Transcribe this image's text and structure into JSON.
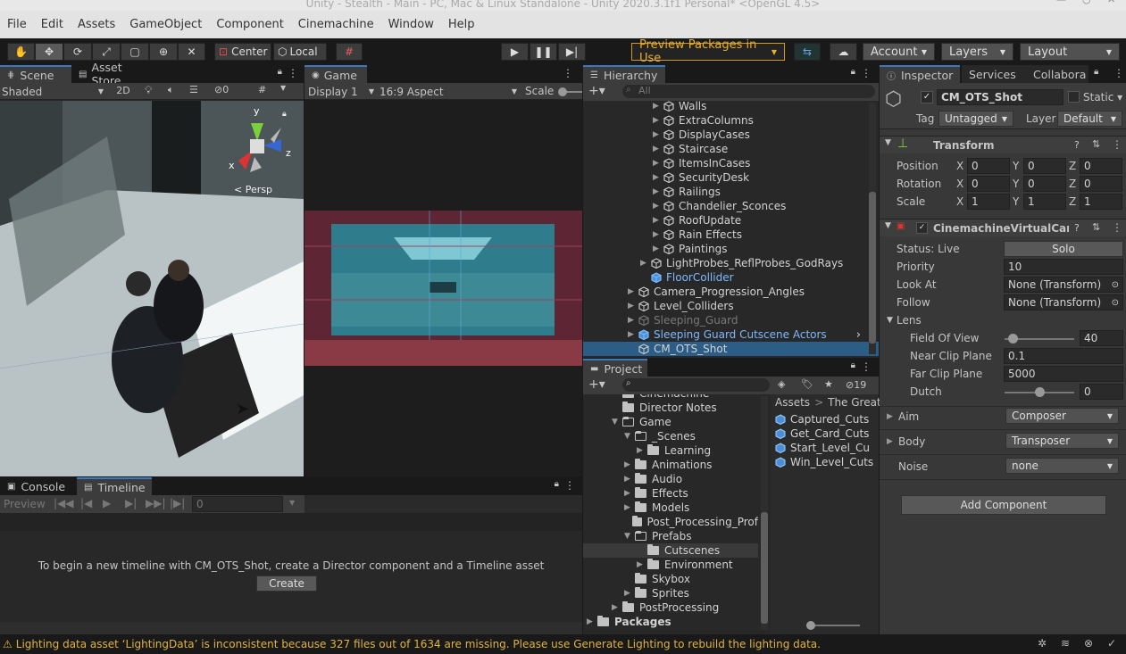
{
  "window": {
    "title": "Unity - Stealth - Main - PC, Mac & Linux Standalone - Unity 2020.3.1f1 Personal* <OpenGL 4.5>"
  },
  "menu": [
    "File",
    "Edit",
    "Assets",
    "GameObject",
    "Component",
    "Cinemachine",
    "Window",
    "Help"
  ],
  "toolbar": {
    "pivot_center": "Center",
    "pivot_local": "Local",
    "preview_packages": "Preview Packages in Use",
    "account": "Account",
    "layers": "Layers",
    "layout": "Layout"
  },
  "scene": {
    "tab_scene": "Scene",
    "tab_asset_store": "Asset Store",
    "shading": "Shaded",
    "mode_2d": "2D",
    "hidden_count": "0",
    "gizmo_persp": "< Persp",
    "axis_x": "x",
    "axis_y": "y",
    "axis_z": "z"
  },
  "game": {
    "tab": "Game",
    "display": "Display 1",
    "aspect": "16:9 Aspect",
    "scale_label": "Scale"
  },
  "hierarchy": {
    "tab": "Hierarchy",
    "search_placeholder": "All",
    "items": [
      {
        "label": "Walls",
        "indent": 5,
        "arrow": true,
        "style": "normal"
      },
      {
        "label": "ExtraColumns",
        "indent": 5,
        "arrow": true,
        "style": "normal"
      },
      {
        "label": "DisplayCases",
        "indent": 5,
        "arrow": true,
        "style": "normal"
      },
      {
        "label": "Staircase",
        "indent": 5,
        "arrow": true,
        "style": "normal"
      },
      {
        "label": "ItemsInCases",
        "indent": 5,
        "arrow": true,
        "style": "normal"
      },
      {
        "label": "SecurityDesk",
        "indent": 5,
        "arrow": true,
        "style": "normal"
      },
      {
        "label": "Railings",
        "indent": 5,
        "arrow": true,
        "style": "normal"
      },
      {
        "label": "Chandelier_Sconces",
        "indent": 5,
        "arrow": true,
        "style": "normal"
      },
      {
        "label": "RoofUpdate",
        "indent": 5,
        "arrow": true,
        "style": "normal"
      },
      {
        "label": "Rain Effects",
        "indent": 5,
        "arrow": true,
        "style": "normal"
      },
      {
        "label": "Paintings",
        "indent": 5,
        "arrow": true,
        "style": "normal"
      },
      {
        "label": "LightProbes_ReflProbes_GodRays",
        "indent": 4,
        "arrow": true,
        "style": "normal"
      },
      {
        "label": "FloorCollider",
        "indent": 4,
        "arrow": false,
        "style": "prefab"
      },
      {
        "label": "Camera_Progression_Angles",
        "indent": 3,
        "arrow": true,
        "style": "normal"
      },
      {
        "label": "Level_Colliders",
        "indent": 3,
        "arrow": true,
        "style": "normal"
      },
      {
        "label": "Sleeping_Guard",
        "indent": 3,
        "arrow": true,
        "style": "disabled"
      },
      {
        "label": "Sleeping Guard Cutscene Actors",
        "indent": 3,
        "arrow": true,
        "style": "prefab"
      },
      {
        "label": "CM_OTS_Shot",
        "indent": 3,
        "arrow": false,
        "style": "selected"
      }
    ]
  },
  "inspector": {
    "tab_inspector": "Inspector",
    "tab_services": "Services",
    "tab_collab": "Collabora",
    "object_name": "CM_OTS_Shot",
    "static_label": "Static",
    "tag_label": "Tag",
    "tag_value": "Untagged",
    "layer_label": "Layer",
    "layer_value": "Default",
    "transform": {
      "title": "Transform",
      "rows": [
        {
          "label": "Position",
          "x": "0",
          "y": "0",
          "z": "0"
        },
        {
          "label": "Rotation",
          "x": "0",
          "y": "0",
          "z": "0"
        },
        {
          "label": "Scale",
          "x": "1",
          "y": "1",
          "z": "1"
        }
      ],
      "x": "X",
      "y": "Y",
      "z": "Z"
    },
    "vcam": {
      "title": "CinemachineVirtualCamer",
      "status_label": "Status: Live",
      "solo": "Solo",
      "priority_label": "Priority",
      "priority": "10",
      "lookat_label": "Look At",
      "lookat": "None (Transform)",
      "follow_label": "Follow",
      "follow": "None (Transform)",
      "lens_label": "Lens",
      "fov_label": "Field Of View",
      "fov": "40",
      "fov_fraction": 0.11,
      "near_label": "Near Clip Plane",
      "near": "0.1",
      "far_label": "Far Clip Plane",
      "far": "5000",
      "dutch_label": "Dutch",
      "dutch": "0",
      "dutch_fraction": 0.5,
      "aim_label": "Aim",
      "aim": "Composer",
      "body_label": "Body",
      "body": "Transposer",
      "noise_label": "Noise",
      "noise": "none"
    },
    "add_component": "Add Component"
  },
  "project": {
    "tab": "Project",
    "hidden_count": "19",
    "tree": [
      {
        "label": "Cinemachine",
        "indent": 2,
        "arrow": "",
        "open": false
      },
      {
        "label": "Director Notes",
        "indent": 2,
        "arrow": "",
        "open": false
      },
      {
        "label": "Game",
        "indent": 2,
        "arrow": "down",
        "open": true
      },
      {
        "label": "_Scenes",
        "indent": 3,
        "arrow": "down",
        "open": true
      },
      {
        "label": "Learning",
        "indent": 4,
        "arrow": "right",
        "open": false
      },
      {
        "label": "Animations",
        "indent": 3,
        "arrow": "right",
        "open": false
      },
      {
        "label": "Audio",
        "indent": 3,
        "arrow": "right",
        "open": false
      },
      {
        "label": "Effects",
        "indent": 3,
        "arrow": "right",
        "open": false
      },
      {
        "label": "Models",
        "indent": 3,
        "arrow": "right",
        "open": false
      },
      {
        "label": "Post_Processing_Prof",
        "indent": 3,
        "arrow": "",
        "open": false
      },
      {
        "label": "Prefabs",
        "indent": 3,
        "arrow": "down",
        "open": true
      },
      {
        "label": "Cutscenes",
        "indent": 4,
        "arrow": "",
        "open": false,
        "selected": true
      },
      {
        "label": "Environment",
        "indent": 4,
        "arrow": "right",
        "open": false
      },
      {
        "label": "Skybox",
        "indent": 3,
        "arrow": "",
        "open": false
      },
      {
        "label": "Sprites",
        "indent": 3,
        "arrow": "right",
        "open": false
      },
      {
        "label": "PostProcessing",
        "indent": 2,
        "arrow": "right",
        "open": false
      },
      {
        "label": "Packages",
        "indent": 0,
        "arrow": "right",
        "open": false,
        "bold": true
      }
    ],
    "breadcrumb": [
      "Assets",
      "The Great"
    ],
    "assets": [
      "Captured_Cuts",
      "Get_Card_Cuts",
      "Start_Level_Cu",
      "Win_Level_Cuts"
    ]
  },
  "console": {
    "tab_console": "Console",
    "tab_timeline": "Timeline",
    "preview": "Preview",
    "frame": "0",
    "message": "To begin a new timeline with CM_OTS_Shot, create a Director component and a Timeline asset",
    "create": "Create"
  },
  "status": {
    "message": "Lighting data asset ‘LightingData’ is inconsistent because 327 files out of 1634 are missing.  Please use Generate Lighting to rebuild the lighting data."
  },
  "colors": {
    "accent": "#3a79bb",
    "selected": "#2c5d87",
    "prefab": "#7cb9ff",
    "warning": "#e0b43c"
  }
}
